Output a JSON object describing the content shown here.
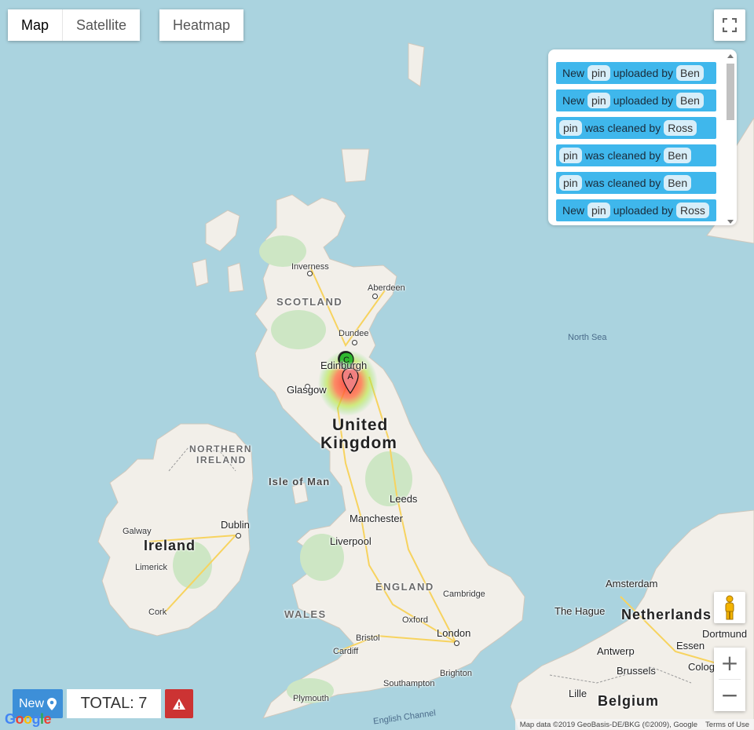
{
  "map_type": {
    "map_label": "Map",
    "satellite_label": "Satellite",
    "active": "Map"
  },
  "heatmap": {
    "label": "Heatmap"
  },
  "feed": {
    "items": [
      {
        "prefix": "New",
        "object": "pin",
        "action": "uploaded by",
        "user": "Ben"
      },
      {
        "prefix": "New",
        "object": "pin",
        "action": "uploaded by",
        "user": "Ben"
      },
      {
        "prefix": "",
        "object": "pin",
        "action": "was cleaned by",
        "user": "Ross"
      },
      {
        "prefix": "",
        "object": "pin",
        "action": "was cleaned by",
        "user": "Ben"
      },
      {
        "prefix": "",
        "object": "pin",
        "action": "was cleaned by",
        "user": "Ben"
      },
      {
        "prefix": "New",
        "object": "pin",
        "action": "uploaded by",
        "user": "Ross"
      }
    ]
  },
  "labels": {
    "inverness": "Inverness",
    "aberdeen": "Aberdeen",
    "scotland": "SCOTLAND",
    "dundee": "Dundee",
    "edinburgh": "Edinburgh",
    "glasgow": "Glasgow",
    "north_sea": "North Sea",
    "uk_line1": "United",
    "uk_line2": "Kingdom",
    "northern_ireland_1": "NORTHERN",
    "northern_ireland_2": "IRELAND",
    "isle_of_man": "Isle of Man",
    "leeds": "Leeds",
    "manchester": "Manchester",
    "liverpool": "Liverpool",
    "galway": "Galway",
    "ireland": "Ireland",
    "dublin": "Dublin",
    "limerick": "Limerick",
    "cork": "Cork",
    "england": "ENGLAND",
    "wales": "WALES",
    "cambridge": "Cambridge",
    "oxford": "Oxford",
    "bristol": "Bristol",
    "cardiff": "Cardiff",
    "london": "London",
    "brighton": "Brighton",
    "southampton": "Southampton",
    "plymouth": "Plymouth",
    "english_channel": "English Channel",
    "amsterdam": "Amsterdam",
    "the_hague": "The Hague",
    "netherlands": "Netherlands",
    "dortmund": "Dortmund",
    "antwerp": "Antwerp",
    "essen": "Essen",
    "brussels": "Brussels",
    "colog": "Colog",
    "lille": "Lille",
    "belgium": "Belgium"
  },
  "markers": [
    {
      "letter": "C",
      "color": "#2fb82f"
    },
    {
      "letter": "A",
      "color": "#f08080"
    }
  ],
  "bottom": {
    "new_label": "New",
    "total_label": "TOTAL: 7"
  },
  "attribution": {
    "data": "Map data ©2019 GeoBasis-DE/BKG (©2009), Google",
    "terms": "Terms of Use"
  },
  "google": "Google",
  "icons": {
    "fullscreen": "fullscreen-icon",
    "pegman": "pegman-icon",
    "zoom_in": "plus-icon",
    "zoom_out": "minus-icon",
    "pin": "map-pin-icon",
    "alert": "warning-icon"
  }
}
